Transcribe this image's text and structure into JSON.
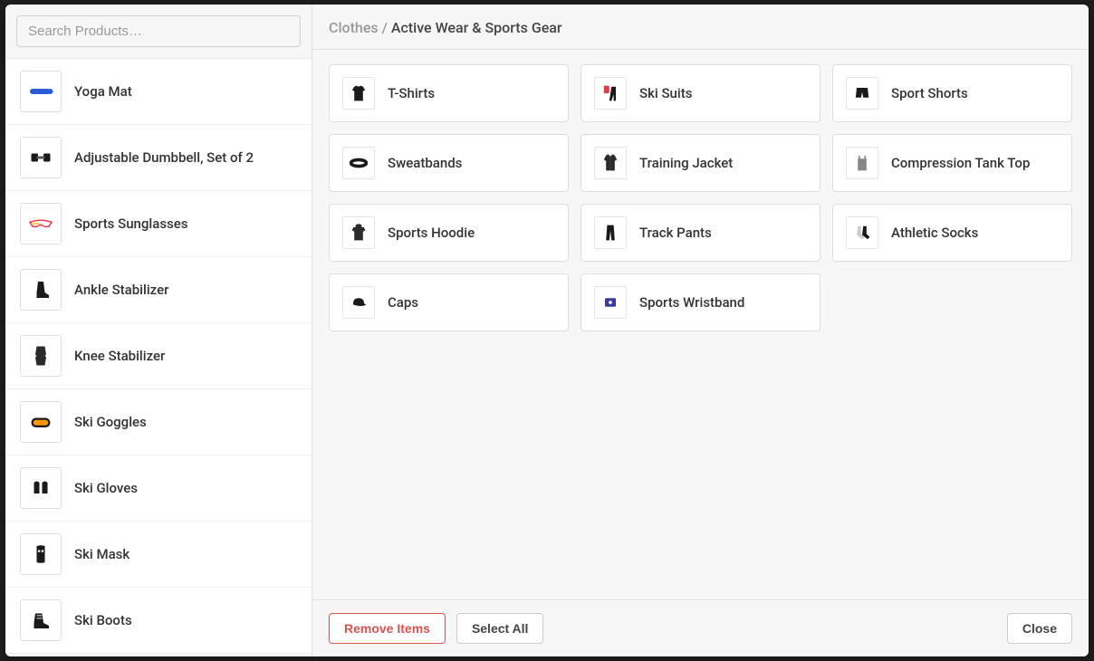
{
  "search": {
    "placeholder": "Search Products…"
  },
  "breadcrumb": {
    "parent": "Clothes",
    "separator": " / ",
    "current": "Active Wear & Sports Gear"
  },
  "sidebar": {
    "items": [
      {
        "label": "Yoga Mat",
        "icon": "yoga-mat"
      },
      {
        "label": "Adjustable Dumbbell, Set of 2",
        "icon": "dumbbell"
      },
      {
        "label": "Sports Sunglasses",
        "icon": "sunglasses"
      },
      {
        "label": "Ankle Stabilizer",
        "icon": "ankle-brace"
      },
      {
        "label": "Knee Stabilizer",
        "icon": "knee-brace"
      },
      {
        "label": "Ski Goggles",
        "icon": "goggles"
      },
      {
        "label": "Ski Gloves",
        "icon": "gloves"
      },
      {
        "label": "Ski Mask",
        "icon": "mask"
      },
      {
        "label": "Ski Boots",
        "icon": "boots"
      }
    ]
  },
  "products": [
    {
      "label": "T-Shirts",
      "icon": "tshirt"
    },
    {
      "label": "Ski Suits",
      "icon": "ski-suit"
    },
    {
      "label": "Sport Shorts",
      "icon": "shorts"
    },
    {
      "label": "Sweatbands",
      "icon": "sweatband"
    },
    {
      "label": "Training Jacket",
      "icon": "jacket"
    },
    {
      "label": "Compression Tank Top",
      "icon": "tank"
    },
    {
      "label": "Sports Hoodie",
      "icon": "hoodie"
    },
    {
      "label": "Track Pants",
      "icon": "pants"
    },
    {
      "label": "Athletic Socks",
      "icon": "socks"
    },
    {
      "label": "Caps",
      "icon": "cap"
    },
    {
      "label": "Sports Wristband",
      "icon": "wristband"
    }
  ],
  "footer": {
    "remove_label": "Remove Items",
    "select_all_label": "Select All",
    "close_label": "Close"
  }
}
